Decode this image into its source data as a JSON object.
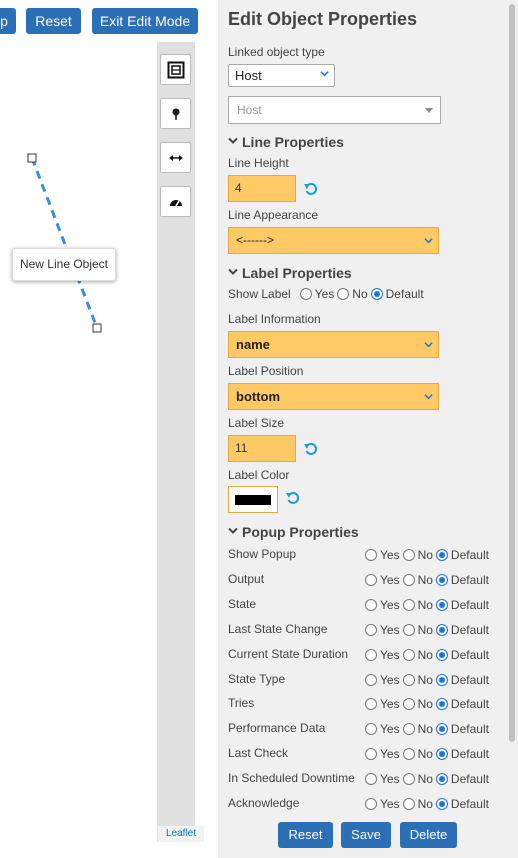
{
  "map": {
    "top_buttons": {
      "cut_label": "p",
      "reset_label": "Reset",
      "exit_label": "Exit Edit Mode"
    },
    "tooltip": "New Line Object",
    "attribution": "Leaflet",
    "tools": [
      {
        "icon": "map-frame-icon"
      },
      {
        "icon": "pin-icon"
      },
      {
        "icon": "horizontal-arrows-icon"
      },
      {
        "icon": "gauge-icon"
      }
    ]
  },
  "panel": {
    "title": "Edit Object Properties",
    "linked_label": "Linked object type",
    "linked_value": "Host",
    "host_select": "Host",
    "line_section": "Line Properties",
    "line_height_label": "Line Height",
    "line_height_value": "4",
    "line_appearance_label": "Line Appearance",
    "line_appearance_value": "<------>",
    "label_section": "Label Properties",
    "show_label": "Show Label",
    "opt_yes": "Yes",
    "opt_no": "No",
    "opt_default": "Default",
    "label_info_label": "Label Information",
    "label_info_value": "name",
    "label_position_label": "Label Position",
    "label_position_value": "bottom",
    "label_size_label": "Label Size",
    "label_size_value": "11",
    "label_color_label": "Label Color",
    "label_color": "#000000",
    "popup_section": "Popup Properties",
    "popup_rows": [
      "Show Popup",
      "Output",
      "State",
      "Last State Change",
      "Current State Duration",
      "State Type",
      "Tries",
      "Performance Data",
      "Last Check",
      "In Scheduled Downtime",
      "Acknowledge"
    ],
    "buttons": {
      "reset": "Reset",
      "save": "Save",
      "delete": "Delete"
    }
  },
  "colors": {
    "accent": "#2b6fb7",
    "highlight": "#ffc966",
    "radio_on": "#1a73e8",
    "line": "#3b8de0"
  }
}
